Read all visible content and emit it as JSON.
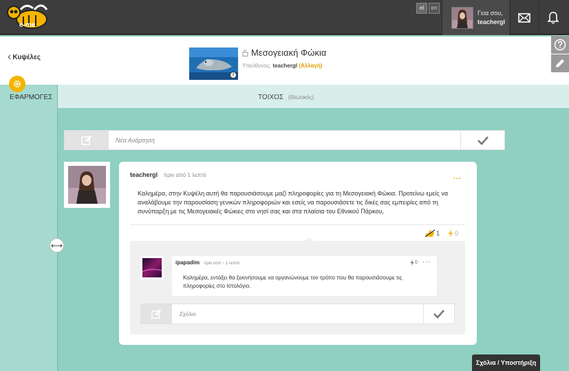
{
  "topbar": {
    "logo_text": "e-me",
    "lang_el": "el",
    "lang_en": "en",
    "greeting": "Γεια σου,",
    "username": "teachergl"
  },
  "header": {
    "back_label": "Κυψέλες",
    "group_title": "Μεσογειακή Φώκια",
    "owner_label": "Υπεύθυνος:",
    "owner_name": "teachergl",
    "change_label": "(Αλλαγή)",
    "info_glyph": "i"
  },
  "apps": {
    "label": "ΕΦΑΡΜΟΓΕΣ"
  },
  "wall": {
    "label": "ΤΟΙΧΟΣ",
    "sub": "(Ιδιωτικός)"
  },
  "new_post": {
    "placeholder": "Νέα Ανάρτηση"
  },
  "post": {
    "author": "teachergl",
    "time": "πριν από 1 λεπτό",
    "more": "...",
    "body": "Καλημέρα, στην Κυψέλη αυτή θα παρουσιάσουμε μαζί πληροφορίες για τη Μεσογειακή Φώκια. Προτείνω εμείς να αναλάβουμε την παρουσίαση γενικών πληροφοριών και εσείς να παρουσιάσετε τις δικές σας εμπειρίες από τη συνύπαρξη με τις Μεσογειακές Φώκιες στο νησί σας και στα πλαίσια του Εθνικού Πάρκου,",
    "likes": "1",
    "bolts": "0"
  },
  "comment": {
    "author": "ipapadim",
    "time": "πριν από ~ 1 λεπτό",
    "bolts": "0",
    "more": "···",
    "body": "Καλημέρα, εντάξει θα ξεκινήσουμε να οργανώνουμε τον τρόπο που θα παρουσιάσουμε τις πληροφορίες στο Ιστολόγιο."
  },
  "comment_input": {
    "placeholder": "Σχόλιο"
  },
  "support": {
    "label": "Σχόλια / Υποστήριξη"
  },
  "colors": {
    "topbar": "#3d3d3d",
    "background": "#8fd0c2",
    "accent": "#f4b400"
  }
}
